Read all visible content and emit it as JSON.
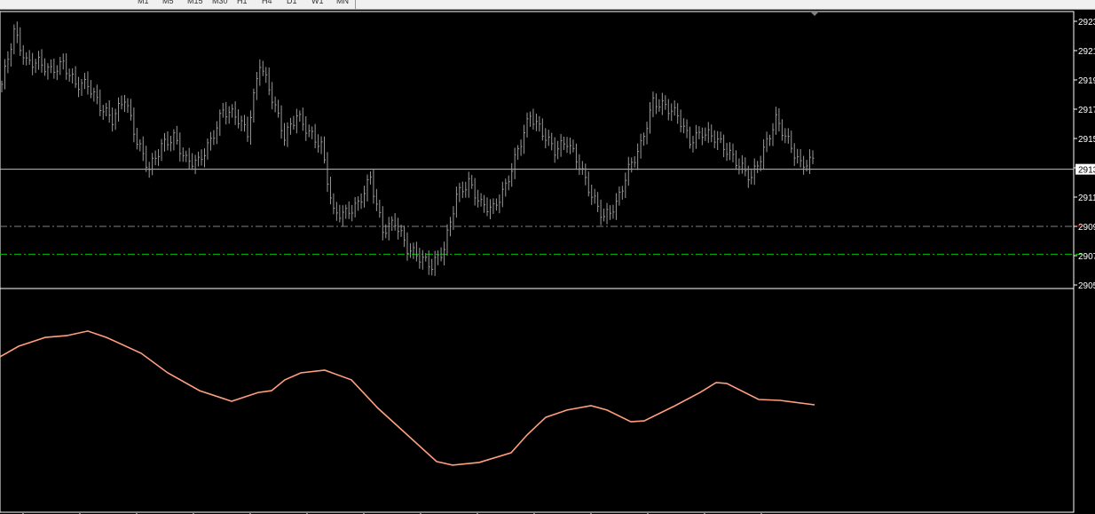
{
  "toolbar": {
    "timeframes": [
      "M1",
      "M5",
      "M15",
      "M30",
      "H1",
      "H4",
      "D1",
      "W1",
      "MN"
    ]
  },
  "colors": {
    "background": "#000000",
    "bars": "#9a9a9a",
    "current_price_line": "#c0c0c0",
    "level_line_gray": "#808080",
    "level_line_green": "#00c000",
    "indicator_line": "#ff9f80",
    "axis": "#ffffff"
  },
  "chart_data": [
    {
      "type": "bar",
      "title": "",
      "y_tick_labels": [
        "2923",
        "2921",
        "2919",
        "2917",
        "2915",
        "2913",
        "2911",
        "2909",
        "2907",
        "2905"
      ],
      "ylim": [
        2905,
        2923
      ],
      "current_price_label": "2913",
      "current_price": 2912.9,
      "levels": [
        {
          "price": 2909.0,
          "style": "dash-dot",
          "color": "gray"
        },
        {
          "price": 2907.1,
          "style": "dash-dot",
          "color": "green"
        }
      ],
      "grid": false,
      "closes": [
        2918.7,
        2922.3,
        2920.2,
        2920.2,
        2919.6,
        2920.1,
        2918.7,
        2918.7,
        2917.2,
        2916.3,
        2917.8,
        2914.8,
        2912.9,
        2914.5,
        2915.1,
        2913.5,
        2913.4,
        2914.8,
        2916.9,
        2916.6,
        2915.4,
        2920.2,
        2917.8,
        2915.1,
        2916.6,
        2915.4,
        2914.5,
        2909.9,
        2909.9,
        2910.5,
        2912.3,
        2908.7,
        2909.3,
        2907.5,
        2906.9,
        2906.3,
        2907.5,
        2911.1,
        2912.0,
        2910.5,
        2910.2,
        2911.7,
        2914.2,
        2916.6,
        2915.4,
        2914.2,
        2914.8,
        2913.2,
        2911.1,
        2909.6,
        2910.5,
        2912.9,
        2914.5,
        2917.5,
        2917.2,
        2916.6,
        2914.8,
        2915.4,
        2915.1,
        2914.2,
        2913.2,
        2912.3,
        2914.2,
        2916.3,
        2914.8,
        2913.2,
        2913.5
      ]
    },
    {
      "type": "line",
      "title": "",
      "ylim": [
        0,
        100
      ],
      "x": [
        0,
        7,
        17,
        25,
        33,
        40,
        53,
        63,
        75,
        87,
        97,
        102,
        107,
        113,
        122,
        132,
        142,
        153,
        164,
        170,
        180,
        192,
        198,
        205,
        213,
        222,
        228,
        237,
        242,
        253,
        263,
        269,
        273,
        285,
        293,
        306
      ],
      "values": [
        69.8,
        74.6,
        78.6,
        79.4,
        81.5,
        78.6,
        71.4,
        62.5,
        54.4,
        49.6,
        53.6,
        54.4,
        59.3,
        62.5,
        63.7,
        59.3,
        46.4,
        34.3,
        22.2,
        20.6,
        21.8,
        26.2,
        34.3,
        42.3,
        45.6,
        47.6,
        45.6,
        40.3,
        40.7,
        47.2,
        53.6,
        58.1,
        57.7,
        50.4,
        50.0,
        48.0
      ]
    }
  ]
}
